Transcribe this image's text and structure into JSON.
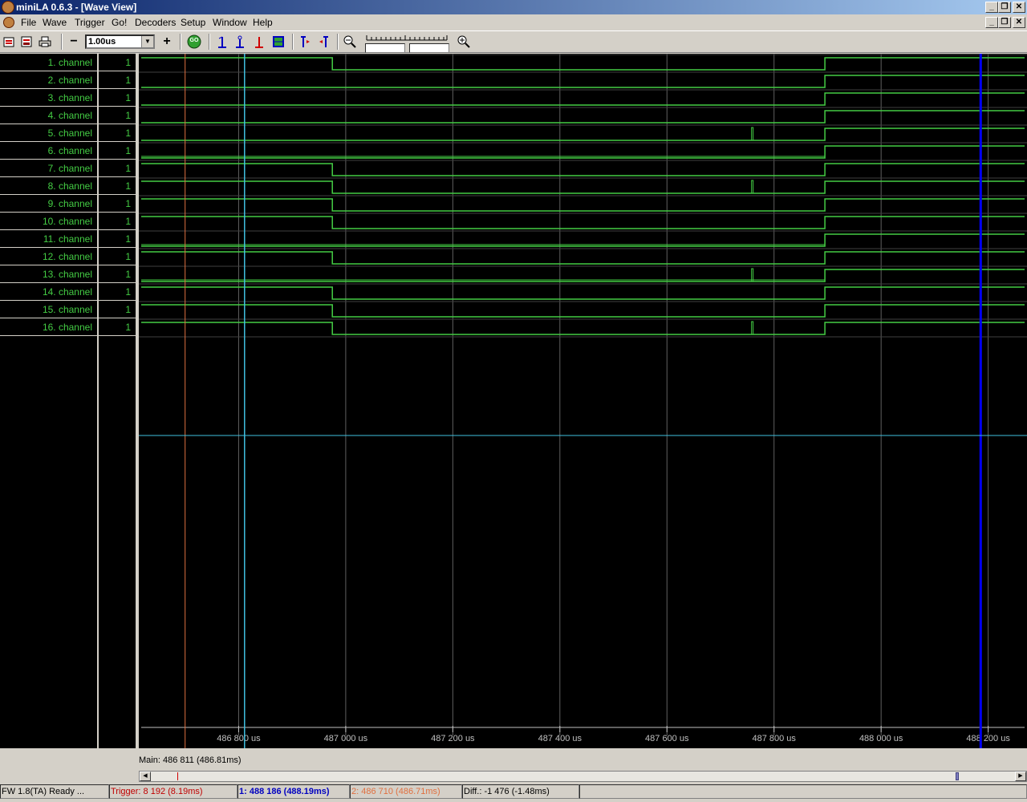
{
  "window": {
    "title": "miniLA 0.6.3 - [Wave View]",
    "caption_buttons": [
      "_",
      "❐",
      "✕"
    ]
  },
  "menu": [
    "File",
    "Wave",
    "Trigger",
    "Go!",
    "Decoders",
    "Setup",
    "Window",
    "Help"
  ],
  "toolbar": {
    "zoom_out_label": "−",
    "zoom_value": "1.00us",
    "zoom_in_label": "+",
    "go_label": "GO",
    "icons": [
      "open-file-icon",
      "save-file-icon",
      "print-icon",
      "go-icon",
      "cursor-1-icon",
      "cursor-2-icon",
      "trigger-cursor-icon",
      "fit-icon",
      "go-to-first-icon",
      "go-to-last-icon",
      "zoom-out-icon",
      "zoom-in-icon"
    ]
  },
  "channels": [
    {
      "name": "1. channel",
      "value": "1"
    },
    {
      "name": "2. channel",
      "value": "1"
    },
    {
      "name": "3. channel",
      "value": "1"
    },
    {
      "name": "4. channel",
      "value": "1"
    },
    {
      "name": "5. channel",
      "value": "1"
    },
    {
      "name": "6. channel",
      "value": "1"
    },
    {
      "name": "7. channel",
      "value": "1"
    },
    {
      "name": "8. channel",
      "value": "1"
    },
    {
      "name": "9. channel",
      "value": "1"
    },
    {
      "name": "10. channel",
      "value": "1"
    },
    {
      "name": "11. channel",
      "value": "1"
    },
    {
      "name": "12. channel",
      "value": "1"
    },
    {
      "name": "13. channel",
      "value": "1"
    },
    {
      "name": "14. channel",
      "value": "1"
    },
    {
      "name": "15. channel",
      "value": "1"
    },
    {
      "name": "16. channel",
      "value": "1"
    }
  ],
  "timeaxis": {
    "labels": [
      "486 800 us",
      "487 000 us",
      "487 200 us",
      "487 400 us",
      "487 600 us",
      "487 800 us",
      "488 000 us",
      "488 200 us"
    ],
    "tick_values_us": [
      486800,
      487000,
      487200,
      487400,
      487600,
      487800,
      488000,
      488200
    ],
    "view_start_us": 486618,
    "view_end_us": 488268
  },
  "cursors": {
    "trigger_us": 486700,
    "cursor1_us": 488186,
    "cursor2_us": 486811,
    "colors": {
      "trigger": "#e07040",
      "cursor1": "#0000ff",
      "cursor2": "#40c0e0"
    }
  },
  "signals": {
    "fall_us": 486975,
    "rise_us": 487895,
    "glitch_us": 487758,
    "pulse_channels": [
      1,
      7,
      8,
      9,
      10,
      12,
      14,
      15,
      16
    ],
    "glitch_channels": [
      5,
      8,
      13,
      16
    ],
    "double_line_channels": [
      6,
      11,
      13
    ],
    "color": "#44cc44"
  },
  "main_label": "Main: 486 811  (486.81ms)",
  "status": {
    "fw": "FW 1.8(TA) Ready ...",
    "trigger": "Trigger: 8 192  (8.19ms)",
    "cursor1": "1: 488 186  (488.19ms)",
    "cursor2": "2: 486 710  (486.71ms)",
    "diff": "Diff.: -1 476  (-1.48ms)"
  },
  "scroll_position": 0.93
}
